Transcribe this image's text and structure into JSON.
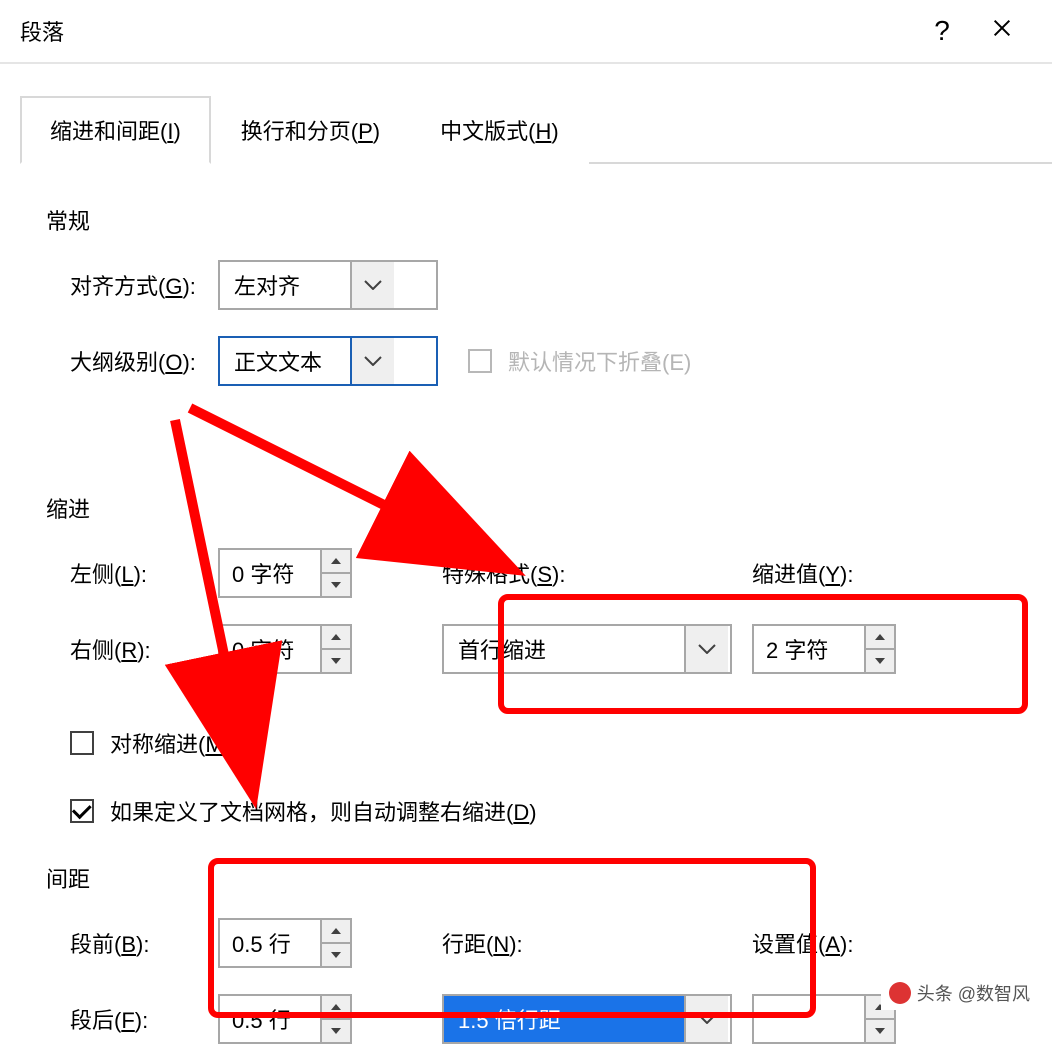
{
  "dialog": {
    "title": "段落",
    "help": "?",
    "close": "×"
  },
  "tabs": {
    "indent": "缩进和间距(I)",
    "pagination": "换行和分页(P)",
    "cjk": "中文版式(H)"
  },
  "general": {
    "section": "常规",
    "align_label": "对齐方式(G):",
    "align_value": "左对齐",
    "outline_label": "大纲级别(O):",
    "outline_value": "正文文本",
    "collapse_label": "默认情况下折叠(E)"
  },
  "indent": {
    "section": "缩进",
    "left_label": "左侧(L):",
    "left_value": "0 字符",
    "right_label": "右侧(R):",
    "right_value": "0 字符",
    "special_label": "特殊格式(S):",
    "special_value": "首行缩进",
    "by_label": "缩进值(Y):",
    "by_value": "2 字符",
    "mirror_label": "对称缩进(M)",
    "autoright_label": "如果定义了文档网格，则自动调整右缩进(D)"
  },
  "spacing": {
    "section": "间距",
    "before_label": "段前(B):",
    "before_value": "0.5 行",
    "after_label": "段后(F):",
    "after_value": "0.5 行",
    "linespace_label": "行距(N):",
    "linespace_value": "1.5 倍行距",
    "at_label": "设置值(A):"
  },
  "watermark": "头条 @数智风"
}
